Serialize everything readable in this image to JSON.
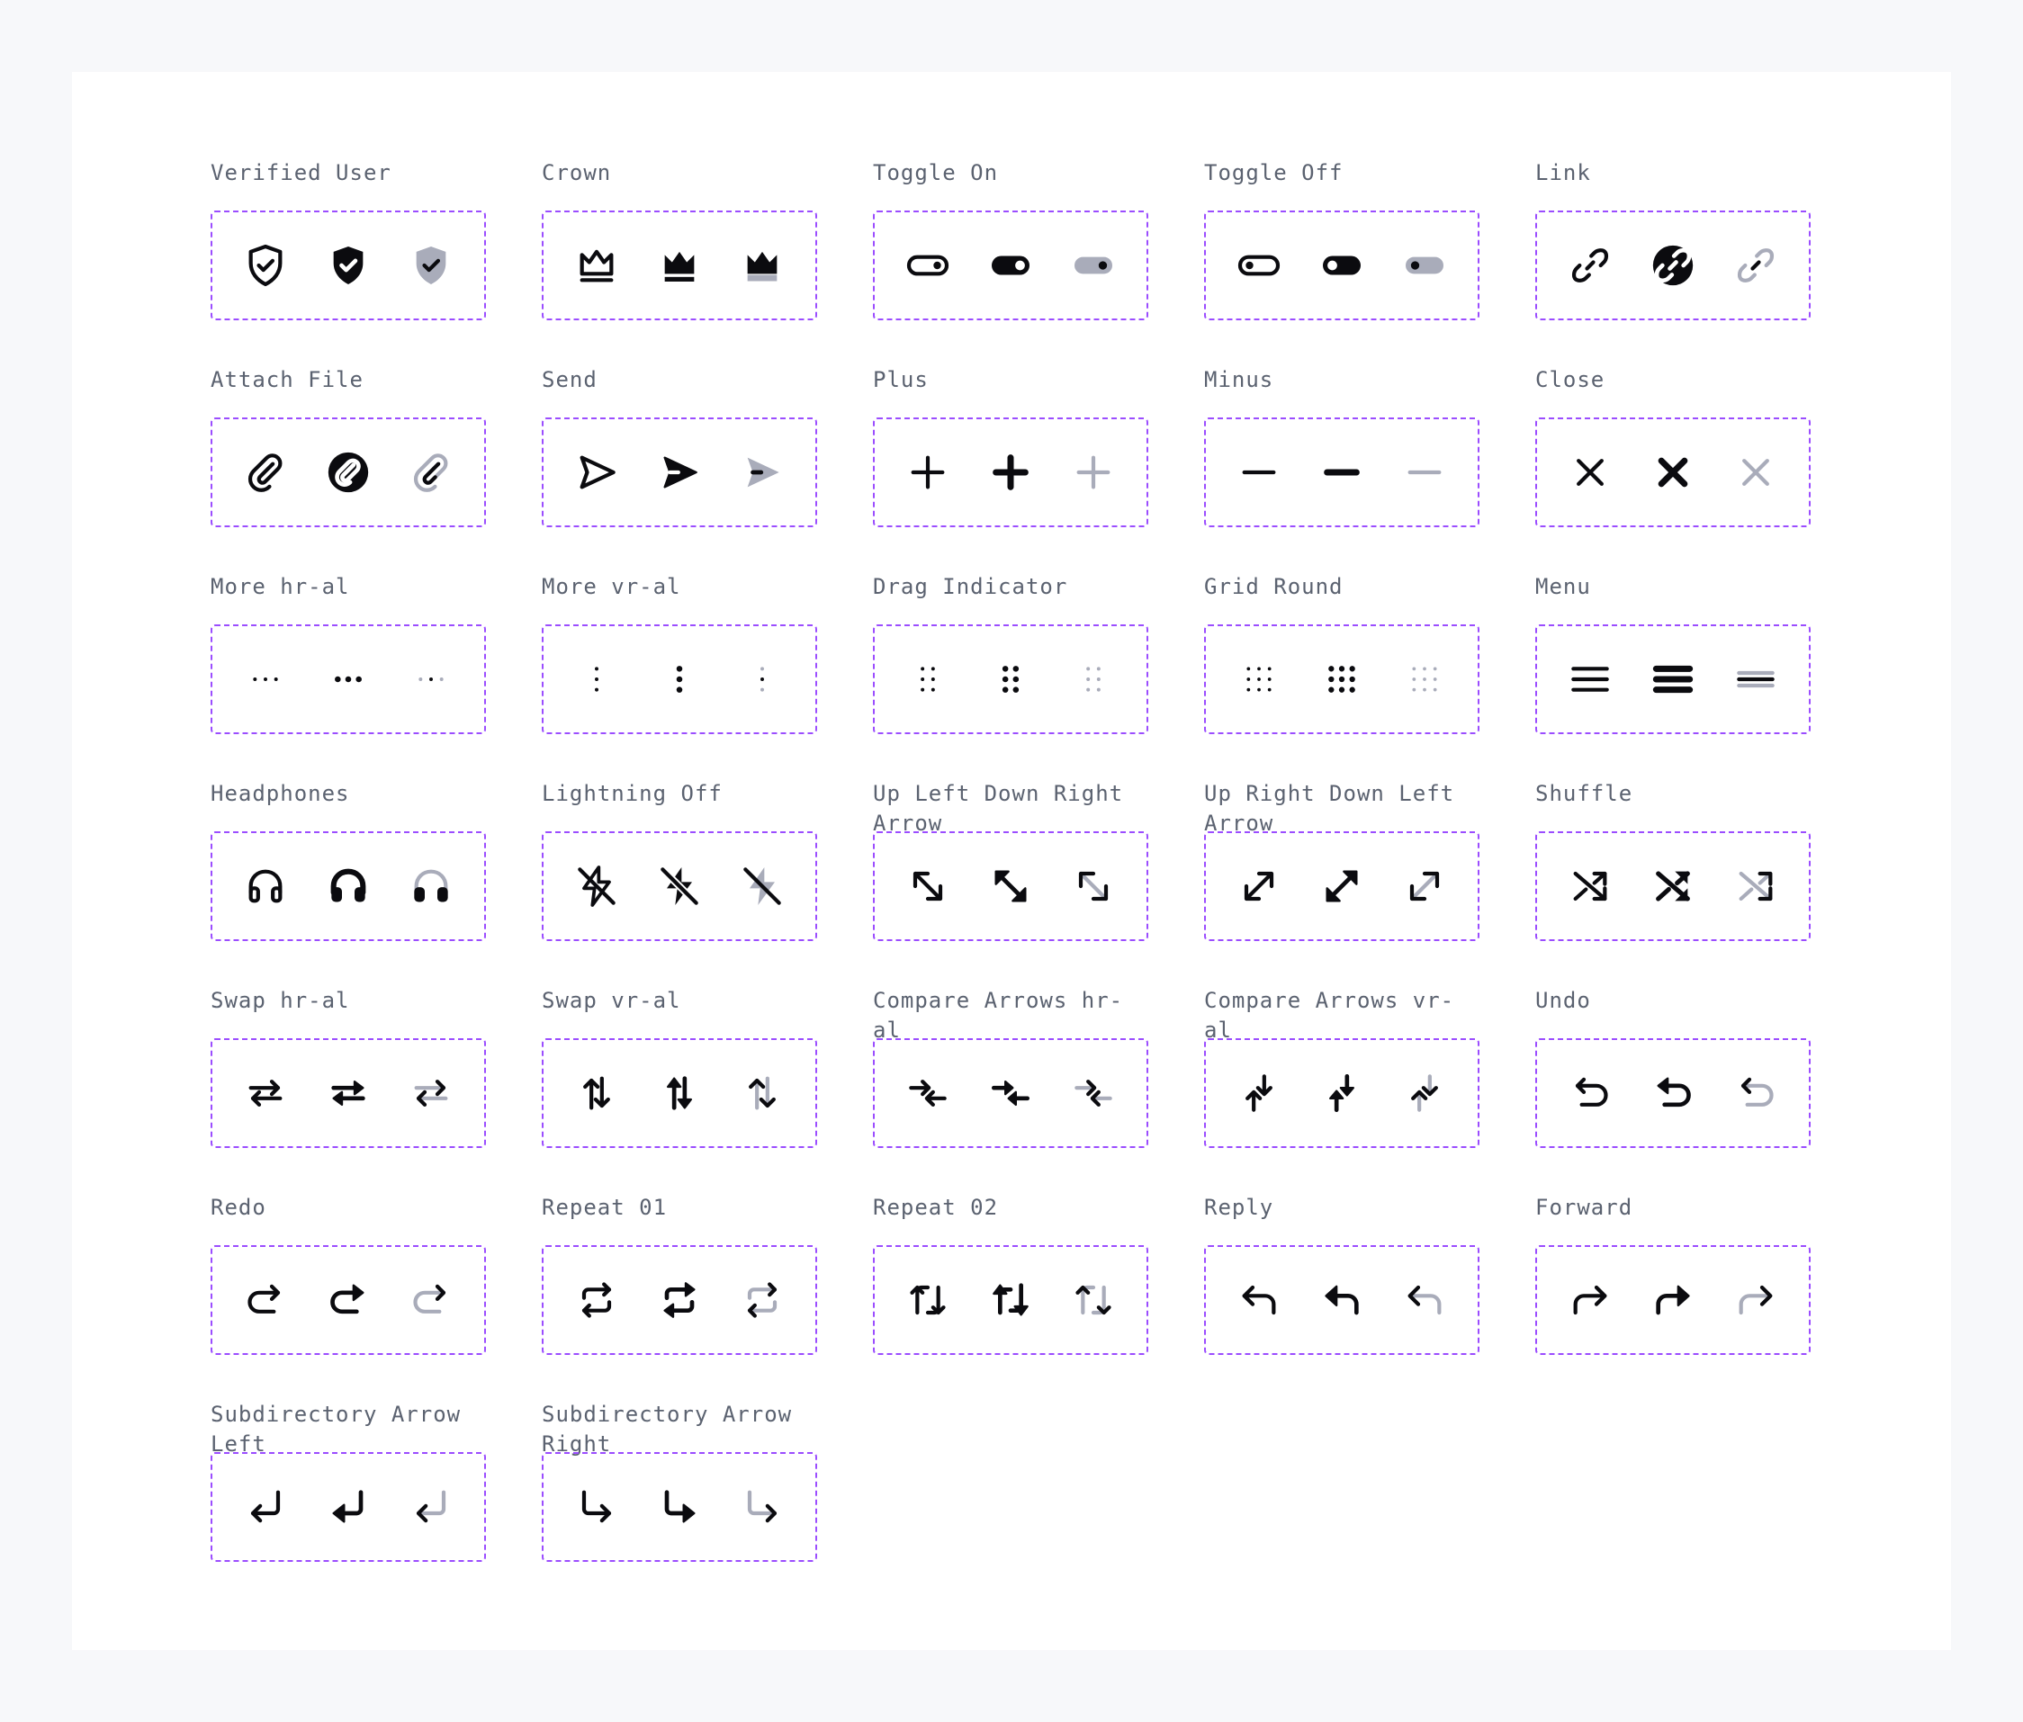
{
  "colors": {
    "page_bg": "#f7f8fa",
    "card_bg": "#ffffff",
    "label": "#5b6270",
    "frame": "#9b4dff",
    "icon": "#0b0b0f",
    "icon_muted": "#a9acba"
  },
  "variants": [
    "outline",
    "bold",
    "duotone"
  ],
  "icons": [
    {
      "label": "Verified User",
      "name": "verified-user"
    },
    {
      "label": "Crown",
      "name": "crown"
    },
    {
      "label": "Toggle On",
      "name": "toggle-on"
    },
    {
      "label": "Toggle Off",
      "name": "toggle-off"
    },
    {
      "label": "Link",
      "name": "link"
    },
    {
      "label": "Attach File",
      "name": "attach-file"
    },
    {
      "label": "Send",
      "name": "send"
    },
    {
      "label": "Plus",
      "name": "plus"
    },
    {
      "label": "Minus",
      "name": "minus"
    },
    {
      "label": "Close",
      "name": "close"
    },
    {
      "label": "More hr-al",
      "name": "more-horizontal"
    },
    {
      "label": "More vr-al",
      "name": "more-vertical"
    },
    {
      "label": "Drag Indicator",
      "name": "drag-indicator"
    },
    {
      "label": "Grid Round",
      "name": "grid-round"
    },
    {
      "label": "Menu",
      "name": "menu"
    },
    {
      "label": "Headphones",
      "name": "headphones"
    },
    {
      "label": "Lightning Off",
      "name": "lightning-off"
    },
    {
      "label": "Up Left Down Right Arrow",
      "name": "up-left-down-right-arrow"
    },
    {
      "label": "Up Right Down Left Arrow",
      "name": "up-right-down-left-arrow"
    },
    {
      "label": "Shuffle",
      "name": "shuffle"
    },
    {
      "label": "Swap hr-al",
      "name": "swap-horizontal"
    },
    {
      "label": "Swap vr-al",
      "name": "swap-vertical"
    },
    {
      "label": "Compare Arrows hr-al",
      "name": "compare-arrows-horizontal"
    },
    {
      "label": "Compare Arrows vr-al",
      "name": "compare-arrows-vertical"
    },
    {
      "label": "Undo",
      "name": "undo"
    },
    {
      "label": "Redo",
      "name": "redo"
    },
    {
      "label": "Repeat 01",
      "name": "repeat-01"
    },
    {
      "label": "Repeat 02",
      "name": "repeat-02"
    },
    {
      "label": "Reply",
      "name": "reply"
    },
    {
      "label": "Forward",
      "name": "forward"
    },
    {
      "label": "Subdirectory Arrow Left",
      "name": "subdirectory-arrow-left"
    },
    {
      "label": "Subdirectory Arrow Right",
      "name": "subdirectory-arrow-right"
    }
  ]
}
